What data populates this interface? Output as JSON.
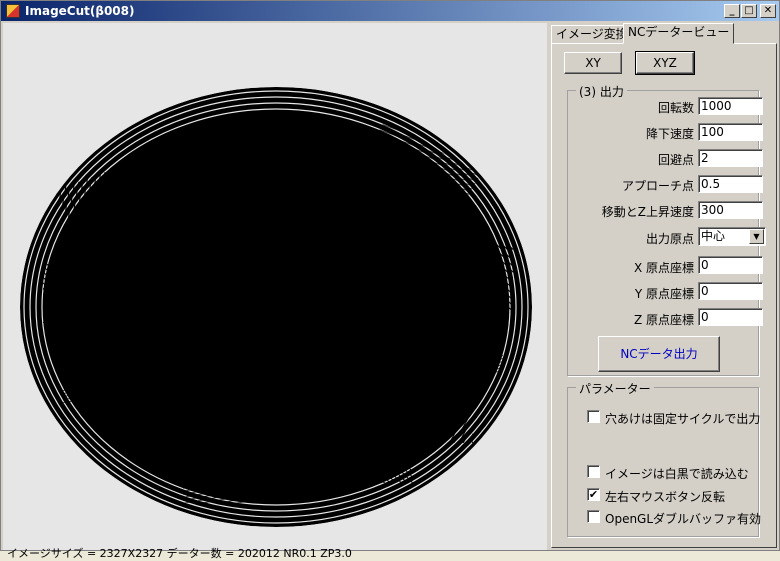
{
  "window": {
    "title": "ImageCut(β008)",
    "controls": {
      "minimize": "_",
      "maximize": "□",
      "close": "✕"
    }
  },
  "status_bar": {
    "text": "イメージサイズ = 2327X2327  データー数 = 202012  NR0.1 ZP3.0"
  },
  "tabs": [
    {
      "label": "イメージ変換",
      "active": false
    },
    {
      "label": "NCデータービュー",
      "active": true
    }
  ],
  "view_buttons": {
    "xy": "XY",
    "xyz": "XYZ"
  },
  "output_group": {
    "legend": "(3) 出力",
    "fields": [
      {
        "label": "回転数",
        "value": "1000"
      },
      {
        "label": "降下速度",
        "value": "100"
      },
      {
        "label": "回避点",
        "value": "2"
      },
      {
        "label": "アプローチ点",
        "value": "0.5"
      },
      {
        "label": "移動とZ上昇速度",
        "value": "300"
      }
    ],
    "origin": {
      "label": "出力原点",
      "selected": "中心"
    },
    "coords": [
      {
        "label": "X 原点座標",
        "value": "0"
      },
      {
        "label": "Y 原点座標",
        "value": "0"
      },
      {
        "label": "Z 原点座標",
        "value": "0"
      }
    ],
    "output_button": "NCデータ出力"
  },
  "params_group": {
    "legend": "パラメーター",
    "checkboxes": [
      {
        "label": "穴あけは固定サイクルで出力",
        "checked": false
      },
      {
        "label": "イメージは白黒で読み込む",
        "checked": false
      },
      {
        "label": "左右マウスボタン反転",
        "checked": true
      },
      {
        "label": "OpenGLダブルバッファ有効",
        "checked": false
      }
    ]
  },
  "colors": {
    "title_start": "#0a246a",
    "title_end": "#a6caf0",
    "link_text": "#0000c0"
  }
}
